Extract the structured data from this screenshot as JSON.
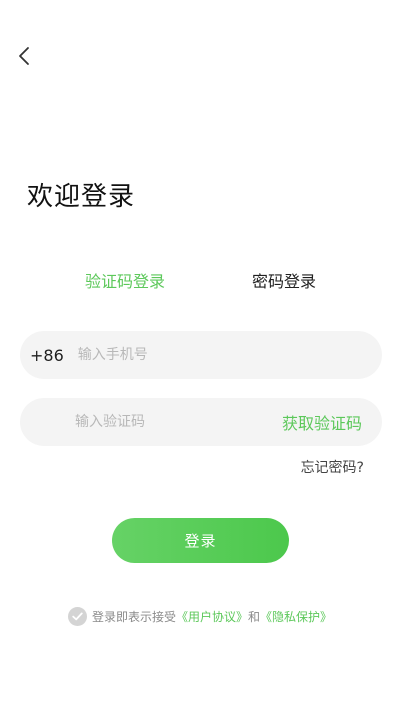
{
  "header": {
    "back_icon": "chevron-left-icon"
  },
  "title": "欢迎登录",
  "tabs": [
    {
      "label": "验证码登录",
      "active": true
    },
    {
      "label": "密码登录",
      "active": false
    }
  ],
  "phone_field": {
    "country_code": "+86",
    "placeholder": "输入手机号",
    "value": ""
  },
  "code_field": {
    "placeholder": "输入验证码",
    "value": "",
    "get_code_label": "获取验证码"
  },
  "forgot_label": "忘记密码?",
  "login_label": "登录",
  "agreement": {
    "checked": false,
    "prefix": "登录即表示接受",
    "user_agreement": "《用户协议》",
    "conjunction": "和",
    "privacy_policy": "《隐私保护》"
  },
  "colors": {
    "accent": "#5cc85a",
    "field_bg": "#f4f4f4",
    "check_bg": "#d4d4d4"
  }
}
